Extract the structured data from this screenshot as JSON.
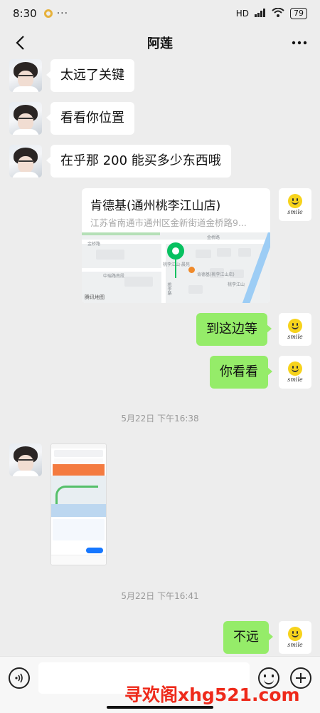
{
  "status_bar": {
    "time": "8:30",
    "more": "···",
    "network": "HD",
    "battery": "79"
  },
  "header": {
    "title": "阿莲",
    "back_icon": "chevron-left-icon",
    "more_icon": "more-dots-icon"
  },
  "messages": [
    {
      "side": "left",
      "type": "text",
      "text": "太远了关键"
    },
    {
      "side": "left",
      "type": "text",
      "text": "看看你位置"
    },
    {
      "side": "left",
      "type": "text",
      "text": "在乎那 200 能买多少东西哦"
    },
    {
      "side": "right",
      "type": "location",
      "title": "肯德基(通州桃李江山店)",
      "address": "江苏省南通市通州区金新街道金桥路9...",
      "map_labels": {
        "road_top": "金桥路",
        "road_left": "金桥路",
        "road_mid": "中瑞路南段",
        "poi_pin": "桃李江山·晨苑",
        "poi_kfc": "肯德基(桃李江山店)",
        "poi_right": "桃李江山",
        "road_vertical": "桃李路",
        "provider": "腾讯地图"
      }
    },
    {
      "side": "right",
      "type": "text",
      "text": "到这边等"
    },
    {
      "side": "right",
      "type": "text",
      "text": "你看看"
    },
    {
      "type": "timestamp",
      "text": "5月22日 下午16:38"
    },
    {
      "side": "left",
      "type": "image",
      "alt_icon": "screenshot-thumbnail"
    },
    {
      "type": "timestamp",
      "text": "5月22日 下午16:41"
    },
    {
      "side": "right",
      "type": "text",
      "text": "不远"
    }
  ],
  "avatar_me_text": "smile",
  "input_bar": {
    "voice_icon": "voice-icon",
    "emoji_icon": "emoji-icon",
    "plus_icon": "plus-icon",
    "placeholder": ""
  },
  "watermark": "寻欢阁xhg521.com",
  "colors": {
    "background": "#ededed",
    "bubble_right": "#95ec69",
    "bubble_left": "#ffffff",
    "pin": "#07c160",
    "watermark": "#ee2a1b"
  }
}
